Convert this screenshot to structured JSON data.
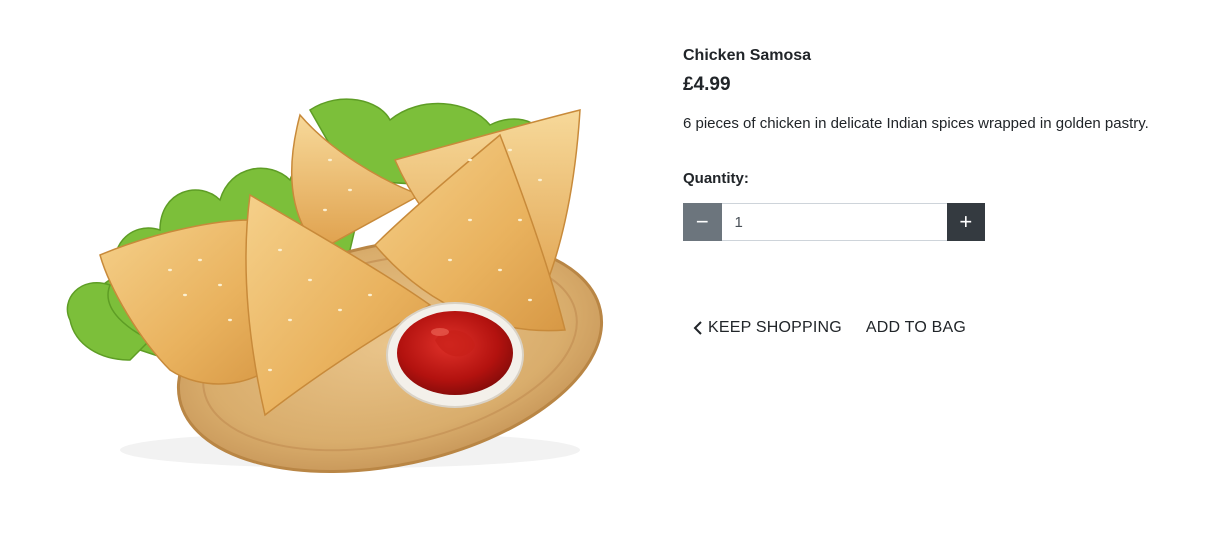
{
  "product": {
    "name": "Chicken Samosa",
    "price": "£4.99",
    "description": "6 pieces of chicken in delicate Indian spices wrapped in golden pastry."
  },
  "quantity": {
    "label": "Quantity:",
    "value": "1",
    "decrement_label": "−",
    "increment_label": "+"
  },
  "actions": {
    "keep_shopping_label": "KEEP SHOPPING",
    "add_to_bag_label": "ADD TO BAG"
  },
  "icons": {
    "back": "chevron-left-icon",
    "minus": "minus-icon",
    "plus": "plus-icon"
  },
  "colors": {
    "decrement_bg": "#6c757d",
    "increment_bg": "#343a40",
    "text": "#212529"
  }
}
